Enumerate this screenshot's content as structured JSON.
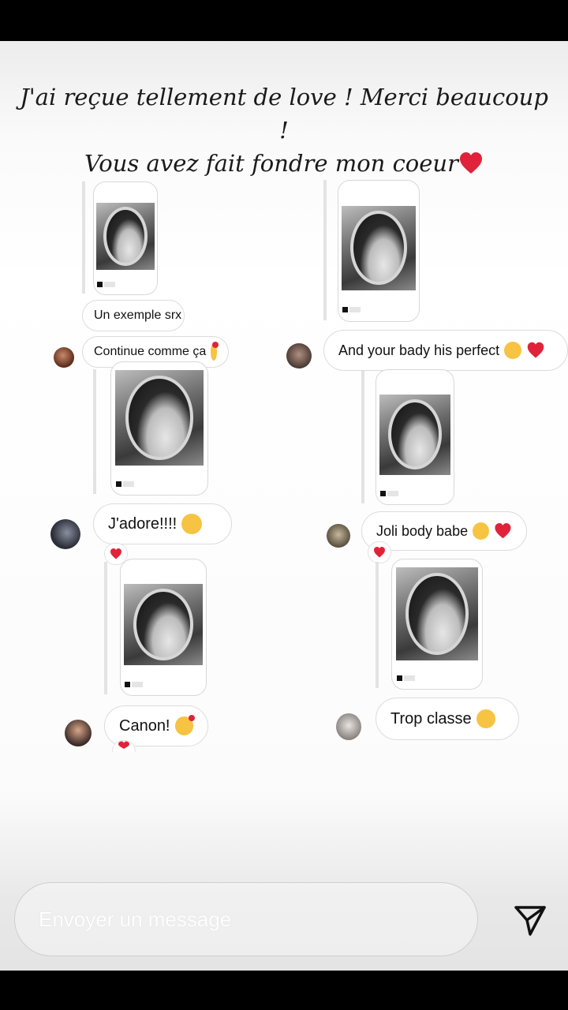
{
  "story": {
    "caption_line1": "J'ai reçue tellement de love ! Merci beaucoup !",
    "caption_line2": "Vous avez fait fondre mon coeur"
  },
  "messages": {
    "left_1": "Un exemple srx",
    "left_2": "Continue comme ça",
    "left_3": "J'adore!!!!",
    "left_4": "Canon!",
    "right_1": "And your bady his perfect",
    "right_2": "Joli body babe",
    "right_3": "Trop classe"
  },
  "composer": {
    "placeholder": "Envoyer un message"
  },
  "icons": {
    "send": "send-icon",
    "heart": "heart-icon"
  },
  "colors": {
    "heart": "#e0233a",
    "emoji": "#f6c343"
  }
}
